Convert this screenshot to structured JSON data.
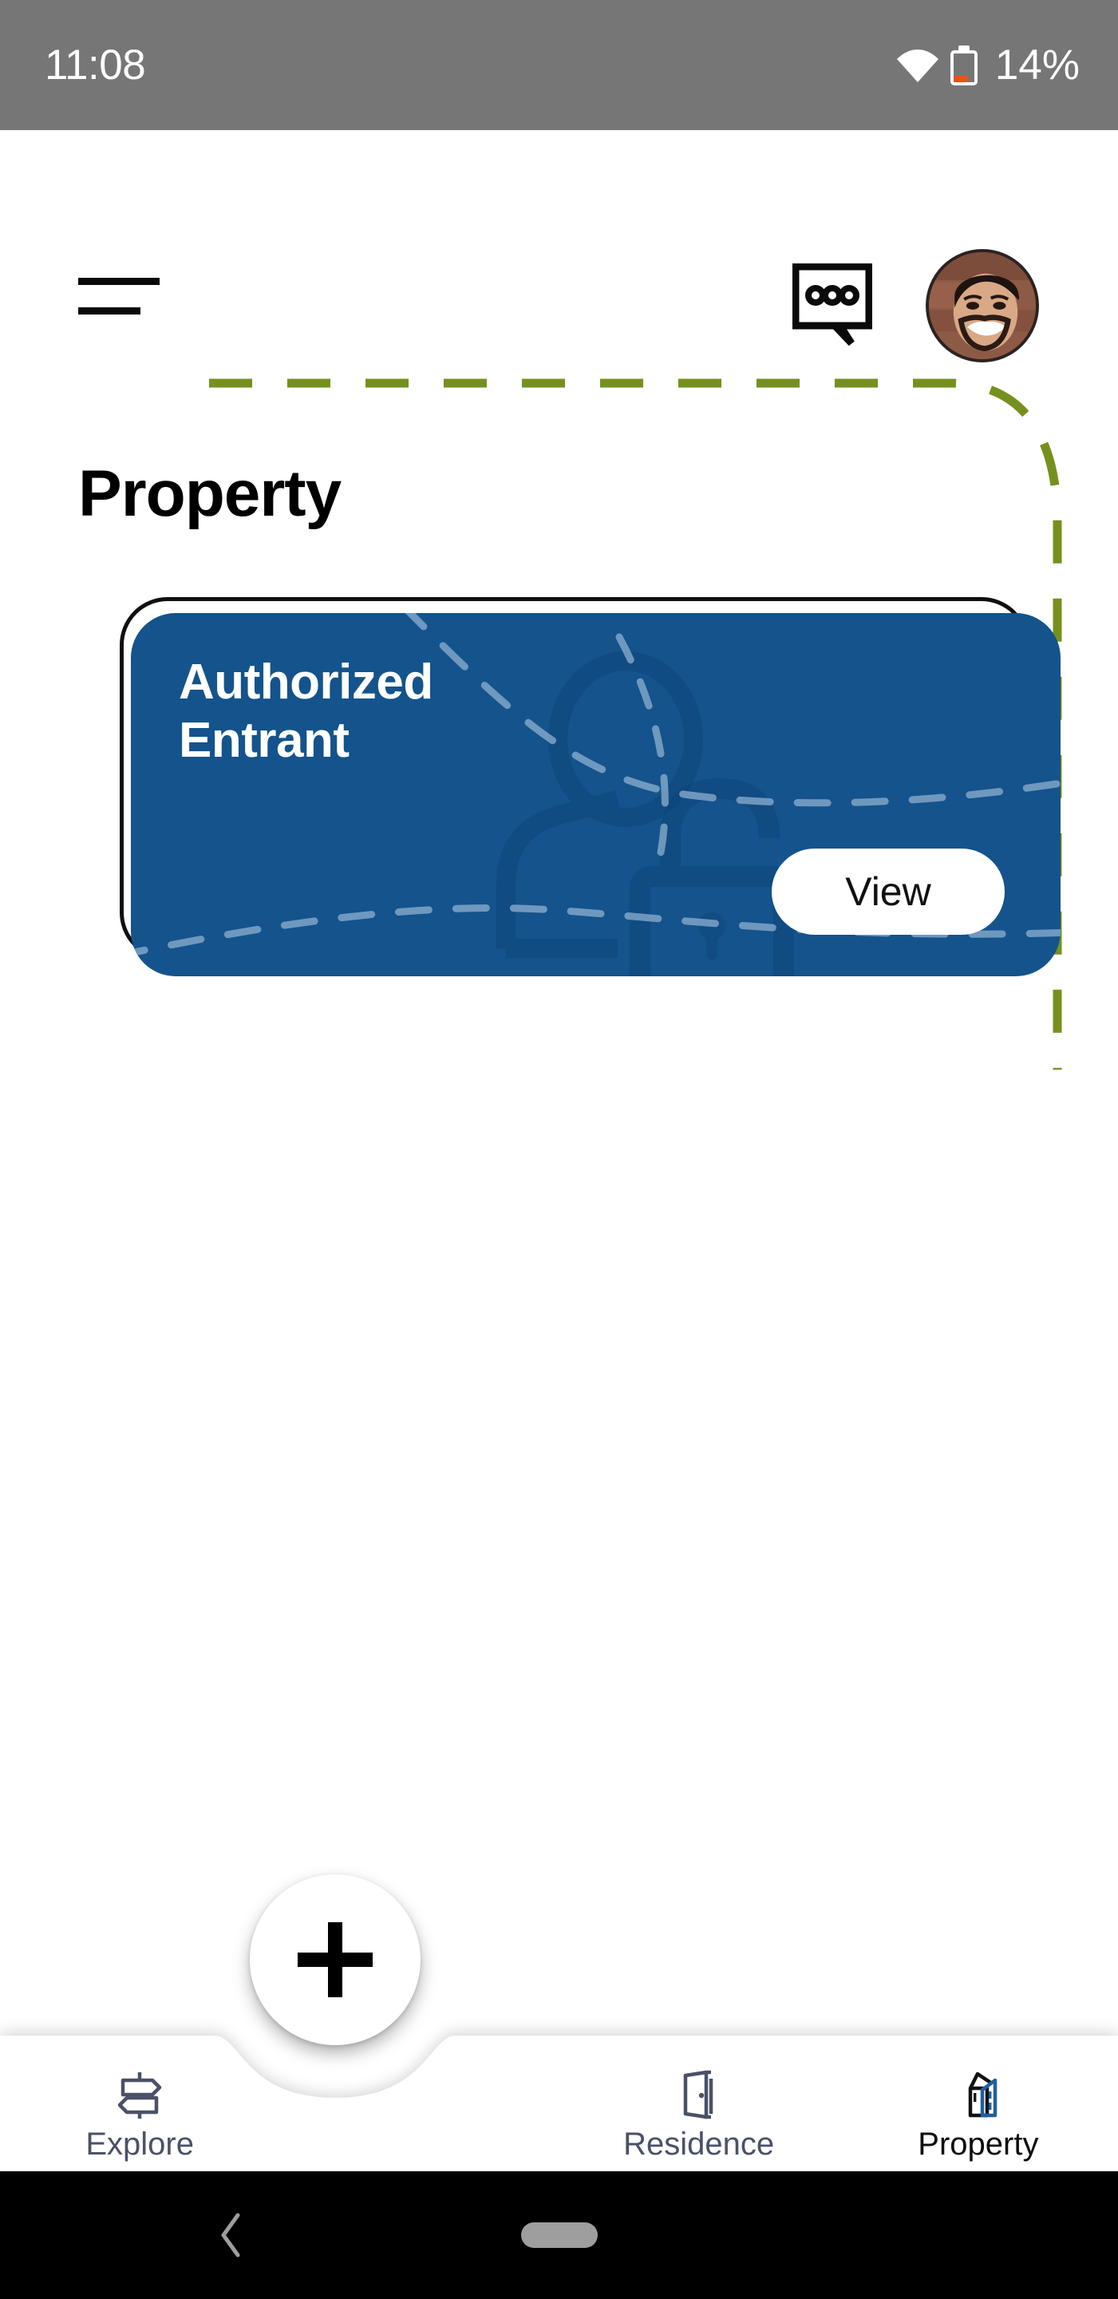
{
  "status_bar": {
    "time": "11:08",
    "battery_percent": "14%",
    "wifi_icon": "wifi-icon",
    "battery_icon": "battery-low-icon",
    "background_color": "#767676",
    "battery_fill_color": "#ef5018"
  },
  "header": {
    "menu_icon": "hamburger-menu-icon",
    "chat_icon": "chat-bubble-dots-icon",
    "avatar_label": "user-avatar"
  },
  "page": {
    "title": "Property",
    "accent_dash_color": "#76901f"
  },
  "card": {
    "title": "Authorized\nEntrant",
    "action_label": "View",
    "background_color": "#14538c",
    "watermark_icon": "person-with-open-padlock-icon"
  },
  "bottom_nav": {
    "fab_icon": "plus-icon",
    "fab_label": "add",
    "items": [
      {
        "label": "Explore",
        "icon": "signpost-icon",
        "active": false
      },
      {
        "label": "Residence",
        "icon": "open-door-icon",
        "active": false
      },
      {
        "label": "Property",
        "icon": "buildings-icon",
        "active": true
      }
    ],
    "active_color": "#0d0d0d",
    "inactive_color": "#4a5168"
  },
  "android_nav": {
    "back_icon": "chevron-left-icon",
    "home_icon": "home-pill-icon",
    "background_color": "#000000"
  }
}
